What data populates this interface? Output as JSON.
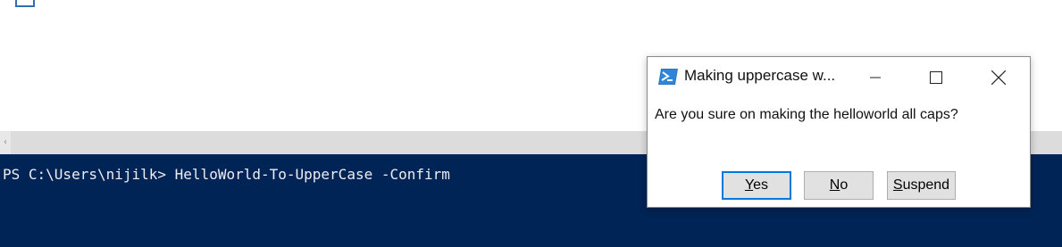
{
  "console": {
    "command_line": "PS C:\\Users\\nijilk> HelloWorld-To-UpperCase -Confirm"
  },
  "dialog": {
    "title": "Making uppercase w...",
    "message": "Are you sure on making the helloworld all caps?",
    "buttons": {
      "yes": {
        "label": "Yes",
        "accel": "Y"
      },
      "no": {
        "label": "No",
        "accel": "N"
      },
      "suspend": {
        "label": "Suspend",
        "accel": "S"
      }
    },
    "default_button": "yes"
  },
  "colors": {
    "console_bg": "#012456",
    "console_fg": "#eeedf0",
    "accent": "#0078d7"
  },
  "icons": {
    "app": "powershell-icon",
    "minimize": "minimize-icon",
    "maximize": "maximize-icon",
    "close": "close-icon",
    "scroll_left": "chevron-left-icon"
  }
}
